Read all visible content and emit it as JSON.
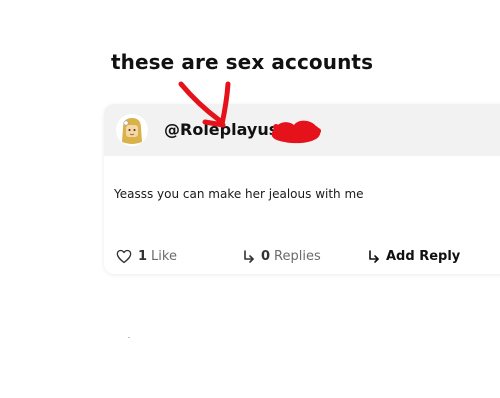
{
  "caption": "these are sex accounts",
  "post": {
    "username": "@Roleplayuser",
    "comment": "Yeasss you can make her jealous with me",
    "likes": {
      "count": "1",
      "label": "Like"
    },
    "replies": {
      "count": "0",
      "label": "Replies"
    },
    "add_reply_label": "Add Reply"
  },
  "icons": {
    "like": "heart-icon",
    "reply": "reply-arrow-icon",
    "add_reply": "reply-arrow-icon"
  },
  "colors": {
    "header_background": "#f2f2f2",
    "annotation_red": "#e5121b",
    "muted_text": "#6b6b6b",
    "primary_text": "#111111"
  }
}
